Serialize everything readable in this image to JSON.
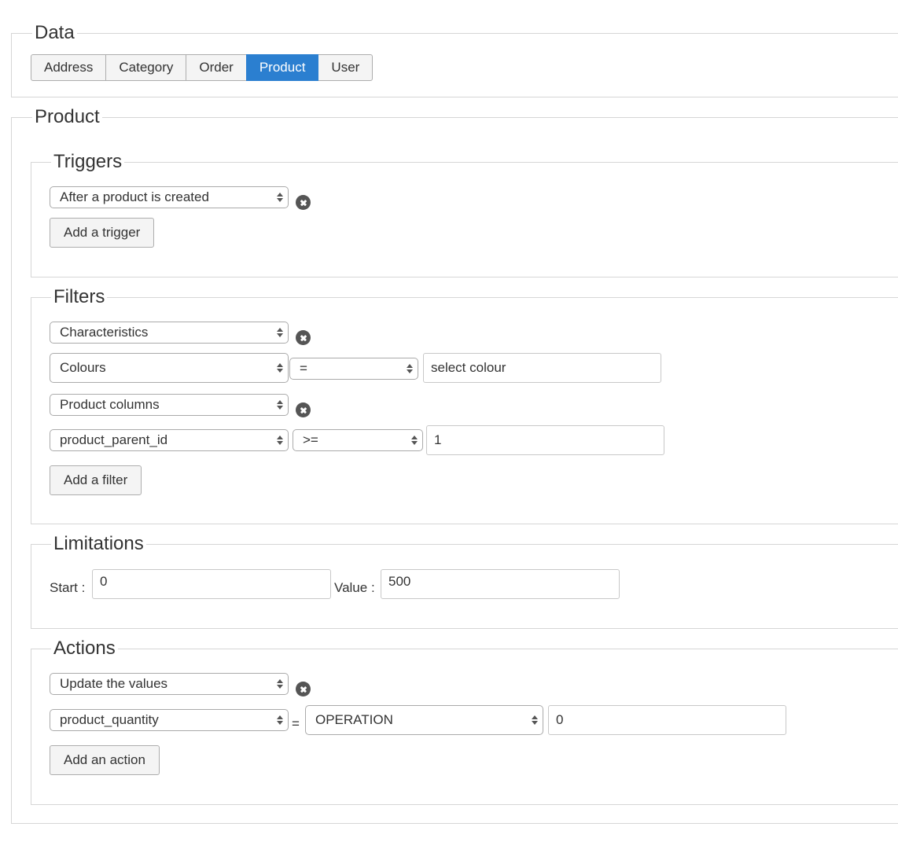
{
  "data_section": {
    "legend": "Data",
    "tabs": [
      {
        "label": "Address",
        "active": false
      },
      {
        "label": "Category",
        "active": false
      },
      {
        "label": "Order",
        "active": false
      },
      {
        "label": "Product",
        "active": true
      },
      {
        "label": "User",
        "active": false
      }
    ]
  },
  "product_section": {
    "legend": "Product",
    "triggers": {
      "legend": "Triggers",
      "trigger_select": "After a product is created",
      "add_button": "Add a trigger"
    },
    "filters": {
      "legend": "Filters",
      "filter1_type": "Characteristics",
      "filter1_field": "Colours",
      "filter1_operator": "=",
      "filter1_value": "select colour",
      "filter2_type": "Product columns",
      "filter2_field": "product_parent_id",
      "filter2_operator": ">=",
      "filter2_value": "1",
      "add_button": "Add a filter"
    },
    "limitations": {
      "legend": "Limitations",
      "start_label": "Start :",
      "start_value": "0",
      "value_label": "Value :",
      "value_value": "500"
    },
    "actions": {
      "legend": "Actions",
      "action_select": "Update the values",
      "field_select": "product_quantity",
      "equals_sign": "=",
      "operation_select": "OPERATION",
      "operation_value": "0",
      "add_button": "Add an action"
    }
  },
  "colors": {
    "active_tab": "#2b7fd0",
    "border": "#d6d6d6",
    "remove_icon": "#555555"
  }
}
